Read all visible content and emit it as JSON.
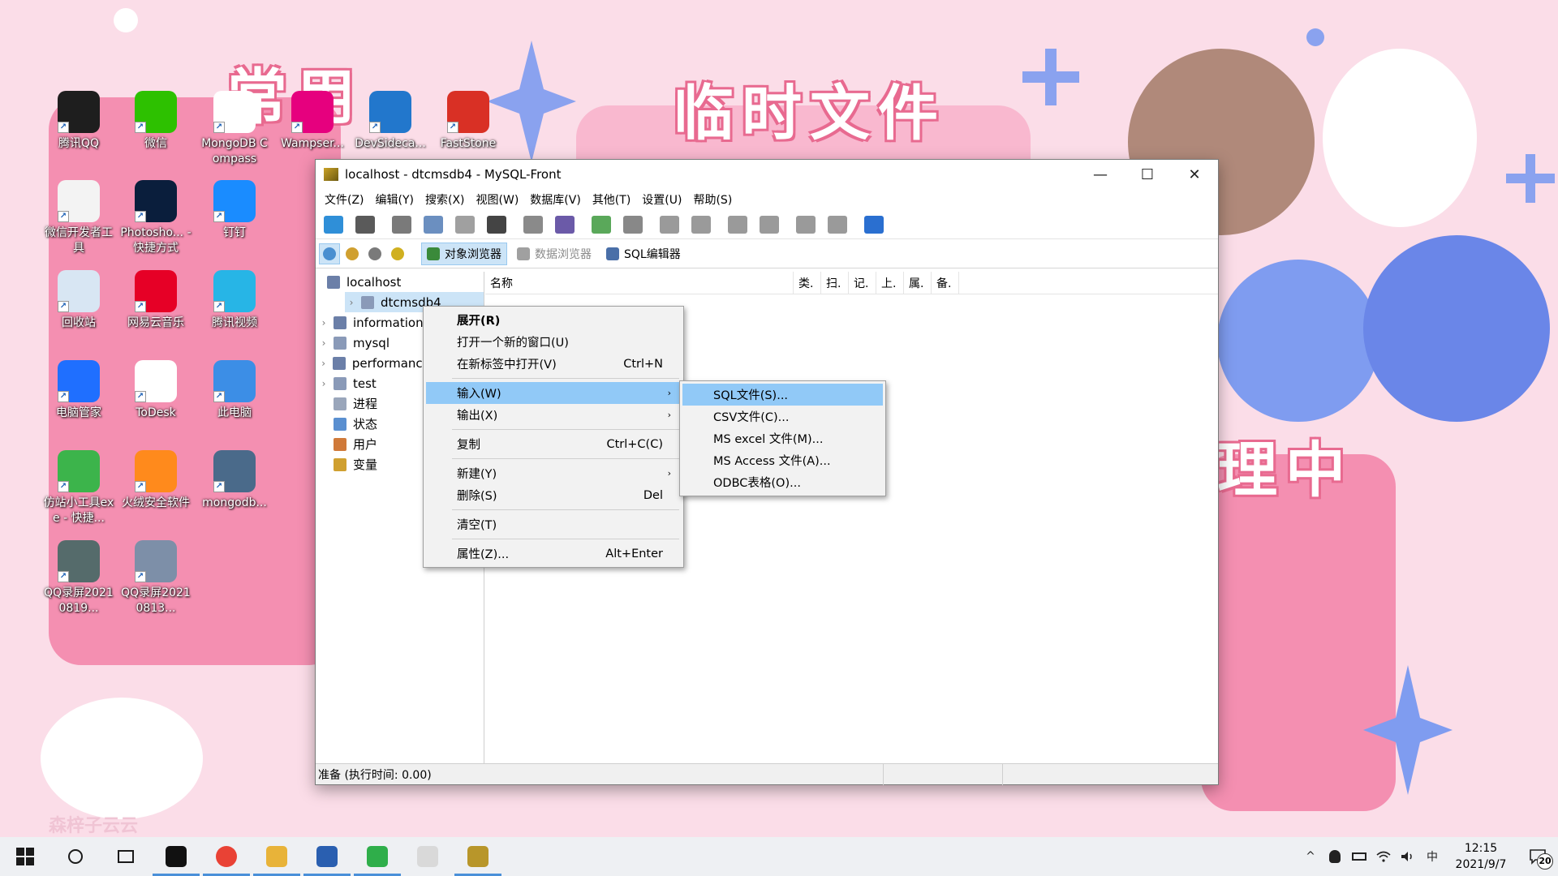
{
  "desktop": {
    "wallpaper_titles": [
      "常用",
      "临时文件",
      "理中"
    ],
    "wallpaper_watermark": "森梓子云云",
    "icons": [
      {
        "label": "腾讯QQ",
        "icon": "qq-icon",
        "color": "#1e1e1e"
      },
      {
        "label": "微信",
        "icon": "wechat-icon",
        "color": "#2dc100"
      },
      {
        "label": "MongoDB Compass",
        "icon": "mongodb-compass-icon",
        "color": "#ffffff"
      },
      {
        "label": "Wampser...",
        "icon": "wampserver-icon",
        "color": "#e6007e"
      },
      {
        "label": "DevSideca...",
        "icon": "devsidecar-icon",
        "color": "#2277cc"
      },
      {
        "label": "FastStone",
        "icon": "faststone-icon",
        "color": "#d93025"
      },
      {
        "label": "微信开发者工具",
        "icon": "wechat-devtools-icon",
        "color": "#f3f3f3"
      },
      {
        "label": "Photosho... - 快捷方式",
        "icon": "photoshop-icon",
        "color": "#0a1e3c"
      },
      {
        "label": "钉钉",
        "icon": "dingtalk-icon",
        "color": "#1a8cff"
      },
      {
        "label": "回收站",
        "icon": "recycle-bin-icon",
        "color": "#d8e6f3"
      },
      {
        "label": "网易云音乐",
        "icon": "netease-music-icon",
        "color": "#e60026"
      },
      {
        "label": "腾讯视频",
        "icon": "tencent-video-icon",
        "color": "#27b5e6"
      },
      {
        "label": "电脑管家",
        "icon": "pc-manager-icon",
        "color": "#1f6fff"
      },
      {
        "label": "ToDesk",
        "icon": "todesk-icon",
        "color": "#ffffff"
      },
      {
        "label": "此电脑",
        "icon": "this-pc-icon",
        "color": "#3c8ee6"
      },
      {
        "label": "仿站小工具exe - 快捷...",
        "icon": "site-tool-icon",
        "color": "#3cb44b"
      },
      {
        "label": "火绒安全软件",
        "icon": "huorong-icon",
        "color": "#ff8a1c"
      },
      {
        "label": "mongodb...",
        "icon": "mongodb-installer-icon",
        "color": "#4a6a8a"
      },
      {
        "label": "QQ录屏20210819...",
        "icon": "qq-screen-record-file-icon",
        "color": "#556b6b"
      },
      {
        "label": "QQ录屏20210813...",
        "icon": "qq-screen-record-file-icon",
        "color": "#7d8fa8"
      }
    ]
  },
  "window": {
    "title": "localhost - dtcmsdb4 - MySQL-Front",
    "controls": {
      "minimize": "—",
      "maximize": "☐",
      "close": "✕"
    },
    "menu": [
      "文件(Z)",
      "编辑(Y)",
      "搜索(X)",
      "视图(W)",
      "数据库(V)",
      "其他(T)",
      "设置(U)",
      "帮助(S)"
    ],
    "toolbar": [
      {
        "name": "refresh",
        "color": "#2f8fd8"
      },
      {
        "name": "stop",
        "color": "#5a5a5a"
      },
      {
        "name": "cut",
        "color": "#7a7a7a"
      },
      {
        "name": "copy",
        "color": "#6b8fc0"
      },
      {
        "name": "paste",
        "color": "#a0a0a0"
      },
      {
        "name": "delete",
        "color": "#444444"
      },
      {
        "name": "database",
        "color": "#8a8a8a"
      },
      {
        "name": "drop-database",
        "color": "#6b5aa8"
      },
      {
        "name": "add-table",
        "color": "#5aa85a"
      },
      {
        "name": "drop-table",
        "color": "#888888"
      },
      {
        "name": "add-field",
        "color": "#9a9a9a"
      },
      {
        "name": "drop-field",
        "color": "#9a9a9a"
      },
      {
        "name": "add-record",
        "color": "#9a9a9a"
      },
      {
        "name": "drop-record",
        "color": "#9a9a9a"
      },
      {
        "name": "connect",
        "color": "#9a9a9a"
      },
      {
        "name": "disconnect",
        "color": "#9a9a9a"
      },
      {
        "name": "checklist",
        "color": "#2a6fd0"
      }
    ],
    "viewbar": {
      "small_buttons": [
        "tree-view-icon",
        "favorites-icon",
        "history-icon",
        "bookmark-icon"
      ],
      "tabs": [
        {
          "label": "对象浏览器",
          "state": "active"
        },
        {
          "label": "数据浏览器",
          "state": "dim"
        },
        {
          "label": "SQL编辑器",
          "state": "normal"
        }
      ]
    },
    "tree": [
      {
        "label": "localhost",
        "chevron": "",
        "icon_color": "#6b7fa8",
        "indent": 0,
        "selected": false
      },
      {
        "label": "dtcmsdb4",
        "chevron": "›",
        "icon_color": "#8a9ab8",
        "indent": 1,
        "selected": true
      },
      {
        "label": "information_schema",
        "chevron": "›",
        "icon_color": "#6b7fa8",
        "indent": 1,
        "selected": false
      },
      {
        "label": "mysql",
        "chevron": "›",
        "icon_color": "#8a9ab8",
        "indent": 1,
        "selected": false
      },
      {
        "label": "performance_schema",
        "chevron": "›",
        "icon_color": "#6b7fa8",
        "indent": 1,
        "selected": false
      },
      {
        "label": "test",
        "chevron": "›",
        "icon_color": "#8a9ab8",
        "indent": 1,
        "selected": false
      },
      {
        "label": "进程",
        "chevron": "",
        "icon_color": "#9aa6bb",
        "indent": 1,
        "selected": false
      },
      {
        "label": "状态",
        "chevron": "",
        "icon_color": "#5a8fd0",
        "indent": 1,
        "selected": false
      },
      {
        "label": "用户",
        "chevron": "",
        "icon_color": "#d07a3a",
        "indent": 1,
        "selected": false
      },
      {
        "label": "变量",
        "chevron": "",
        "icon_color": "#d0a030",
        "indent": 1,
        "selected": false
      }
    ],
    "list_columns": [
      "名称",
      "类.",
      "扫.",
      "记.",
      "上.",
      "属.",
      "备."
    ],
    "status": {
      "left": "准备  (执行时间: 0.00)",
      "middle": "",
      "right": ""
    }
  },
  "context_menu": {
    "items": [
      {
        "label": "展开(R)",
        "shortcut": "",
        "type": "item",
        "bold": true
      },
      {
        "label": "打开一个新的窗口(U)",
        "shortcut": "",
        "type": "item"
      },
      {
        "label": "在新标签中打开(V)",
        "shortcut": "Ctrl+N",
        "type": "item"
      },
      {
        "type": "sep"
      },
      {
        "label": "输入(W)",
        "shortcut": "",
        "type": "item",
        "submenu": true,
        "highlighted": true
      },
      {
        "label": "输出(X)",
        "shortcut": "",
        "type": "item",
        "submenu": true
      },
      {
        "type": "sep"
      },
      {
        "label": "复制",
        "shortcut": "Ctrl+C(C)",
        "type": "item"
      },
      {
        "type": "sep"
      },
      {
        "label": "新建(Y)",
        "shortcut": "",
        "type": "item",
        "submenu": true
      },
      {
        "label": "删除(S)",
        "shortcut": "Del",
        "type": "item"
      },
      {
        "type": "sep"
      },
      {
        "label": "清空(T)",
        "shortcut": "",
        "type": "item"
      },
      {
        "type": "sep"
      },
      {
        "label": "属性(Z)...",
        "shortcut": "Alt+Enter",
        "type": "item"
      }
    ]
  },
  "submenu": {
    "items": [
      {
        "label": "SQL文件(S)...",
        "highlighted": true
      },
      {
        "label": "CSV文件(C)..."
      },
      {
        "label": "MS excel 文件(M)..."
      },
      {
        "label": "MS Access 文件(A)..."
      },
      {
        "label": "ODBC表格(O)..."
      }
    ]
  },
  "taskbar": {
    "apps": [
      {
        "name": "start",
        "color": "#1a1a1a"
      },
      {
        "name": "search",
        "color": "#1a1a1a"
      },
      {
        "name": "task-view",
        "color": "#1a1a1a"
      },
      {
        "name": "qq",
        "color": "#111111",
        "active": true
      },
      {
        "name": "chrome",
        "color": "#e94235",
        "active": true
      },
      {
        "name": "file-explorer",
        "color": "#e8b339",
        "active": true
      },
      {
        "name": "powershell",
        "color": "#2a5fb0",
        "active": true
      },
      {
        "name": "hbuilderx",
        "color": "#2fae4a",
        "active": true
      },
      {
        "name": "wechat-devtools",
        "color": "#d9d9d9"
      },
      {
        "name": "mysql-front",
        "color": "#b8962a",
        "active": true
      }
    ],
    "tray": {
      "chevron": "^",
      "ime": "中",
      "time": "12:15",
      "date": "2021/9/7",
      "notification_count": "20"
    }
  }
}
